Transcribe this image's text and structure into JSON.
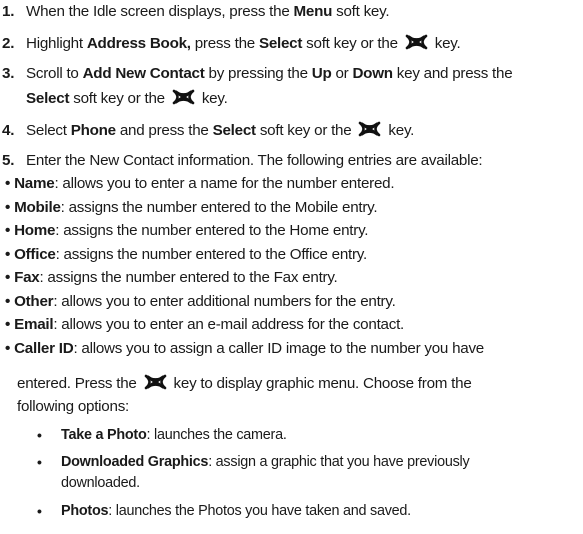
{
  "steps": [
    {
      "num": "1.",
      "t1": "When the Idle screen displays, press the ",
      "b1": "Menu",
      "t2": " soft key."
    },
    {
      "num": "2.",
      "t1": "Highlight ",
      "b1": "Address Book,",
      "t2": " press the ",
      "b2": "Select",
      "t3": " soft key or the ",
      "t4": " key."
    },
    {
      "num": "3.",
      "t1": "Scroll to ",
      "b1": "Add New Contact",
      "t2": " by pressing the ",
      "b2": "Up",
      "t3": " or ",
      "b3": "Down",
      "t4": " key and press the",
      "l2_b1": "Select",
      "l2_t1": " soft key or the ",
      "l2_t2": " key."
    },
    {
      "num": "4.",
      "t1": "Select ",
      "b1": "Phone",
      "t2": " and press the ",
      "b2": "Select",
      "t3": " soft key or the ",
      "t4": " key."
    },
    {
      "num": "5.",
      "t1": "Enter the New Contact information. The following entries are available:"
    }
  ],
  "entries": [
    {
      "term": "Name",
      "desc": ": allows you to enter a name for the number entered."
    },
    {
      "term": "Mobile",
      "desc": ": assigns the number entered to the Mobile entry."
    },
    {
      "term": "Home",
      "desc": ": assigns the number entered to the Home entry."
    },
    {
      "term": "Office",
      "desc": ": assigns the number entered to the Office entry."
    },
    {
      "term": "Fax",
      "desc": ": assigns the number entered to the Fax entry."
    },
    {
      "term": "Other",
      "desc": ": allows you to enter additional numbers for the entry."
    },
    {
      "term": "Email",
      "desc": ": allows you to enter an e-mail address for the contact."
    },
    {
      "term": "Caller ID",
      "desc": ": allows you to assign a caller ID image to the number you have"
    }
  ],
  "caller_id_cont": {
    "l1_t1": "entered. Press the ",
    "l1_t2": " key to display graphic menu. Choose from the",
    "l2": "following options:"
  },
  "options": [
    {
      "term": "Take a Photo",
      "desc": ": launches the camera."
    },
    {
      "term": "Downloaded Graphics",
      "desc": ": assign a graphic that you have previously",
      "cont": "downloaded."
    },
    {
      "term": "Photos",
      "desc": ": launches the Photos you have taken and saved."
    }
  ],
  "bullet_char": "•",
  "key_icon": "nav-select-key-icon"
}
